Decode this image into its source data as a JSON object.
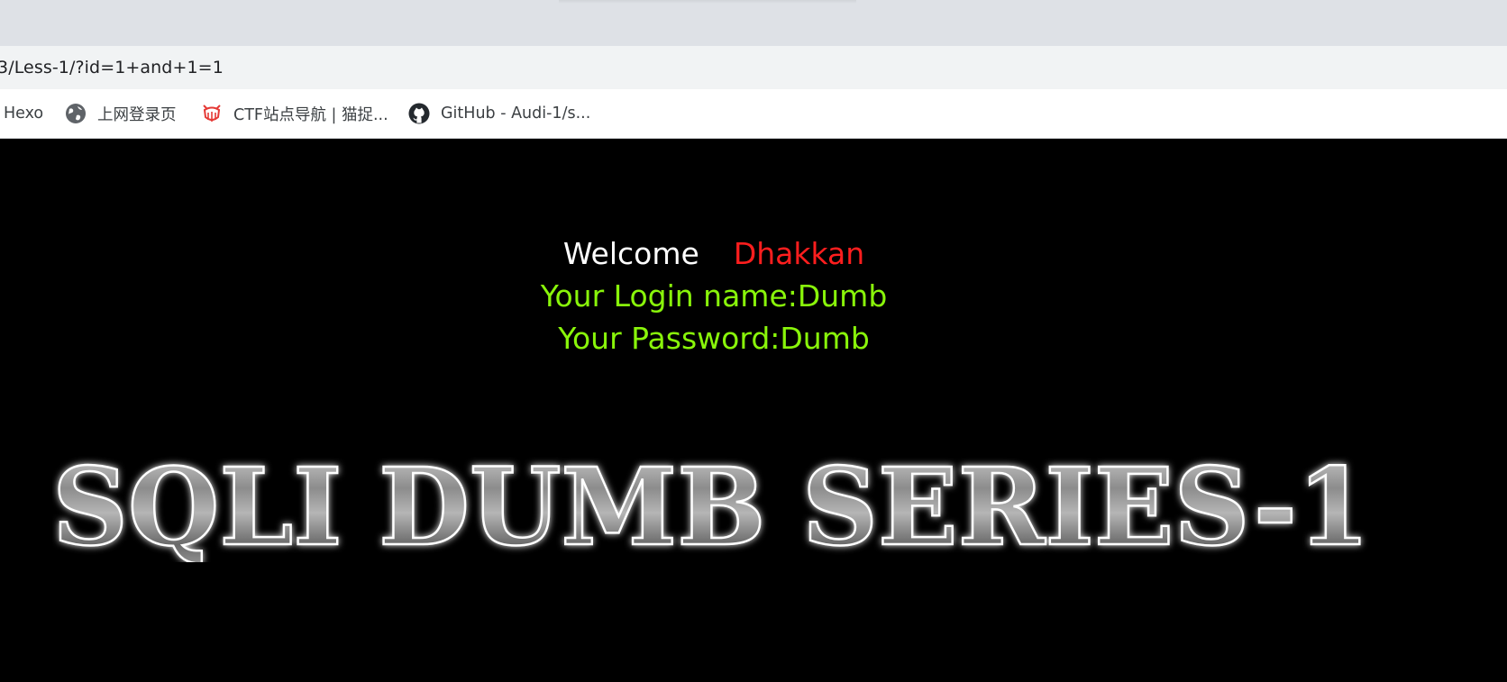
{
  "browser": {
    "address_bar": {
      "url": "3/Less-1/?id=1+and+1=1"
    },
    "bookmarks": [
      {
        "label": "Hexo",
        "icon": "none"
      },
      {
        "label": "上网登录页",
        "icon": "globe-icon"
      },
      {
        "label": "CTF站点导航 | 猫捉...",
        "icon": "cat-icon"
      },
      {
        "label": "GitHub - Audi-1/s...",
        "icon": "github-icon"
      }
    ]
  },
  "page": {
    "welcome": "Welcome",
    "welcome_name": "Dhakkan",
    "login_line": "Your Login name:Dumb",
    "password_line": "Your Password:Dumb",
    "banner_text": "SQLI DUMB SERIES-1",
    "colors": {
      "background": "#000000",
      "welcome": "#ffffff",
      "name": "#ff1e1e",
      "result": "#89f50a"
    }
  }
}
